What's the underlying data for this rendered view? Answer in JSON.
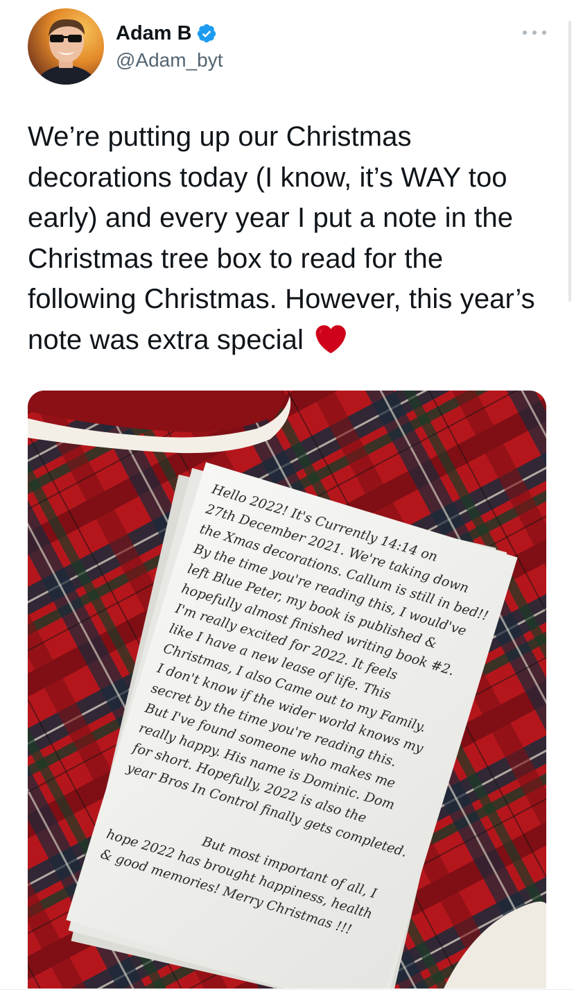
{
  "tweet": {
    "author": {
      "display_name": "Adam B",
      "handle": "@Adam_byt",
      "verified": true
    },
    "text": "We’re putting up our Christmas decorations today (I know, it’s WAY too early) and every year I put a note in the Christmas tree box to read for the following Christmas. However, this year’s note was extra special",
    "emoji": "red-heart-icon",
    "more_icon": "more-horizontal-icon"
  },
  "media": {
    "note_lines": [
      "Hello 2022! It's Currently 14:14 on",
      "27th December 2021. We're taking down",
      "the Xmas decorations. Callum is still in bed!!",
      "By the time you're reading this, I would've",
      "left Blue Peter, my book is published &",
      "hopefully almost finished writing book #2.",
      "I'm really excited for 2022. It feels",
      "like I have a new lease of life. This",
      "Christmas, I also Came out to my Family.",
      "I don't know if the wider world knows my",
      "secret by the time you're reading this.",
      "But I've found someone who makes me",
      "really happy. His name is Dominic. Dom",
      "for short. Hopefully, 2022 is also the",
      "year Bros In Control finally gets completed.",
      "But most important of all, I",
      "hope 2022 has brought happiness, health",
      "& good memories! Merry Christmas !!!"
    ]
  },
  "colors": {
    "text": "#0f1419",
    "secondary": "#536471",
    "verified": "#1d9bf0",
    "heart": "#d0021b",
    "tartan_red": "#b5161c"
  }
}
